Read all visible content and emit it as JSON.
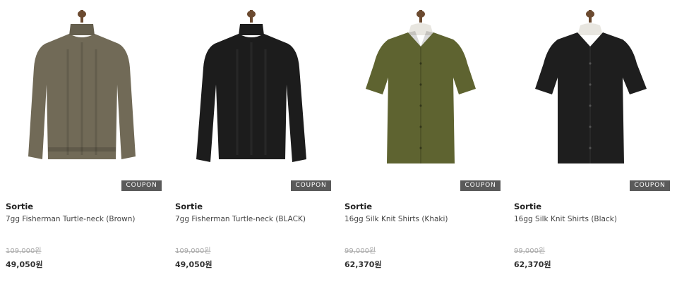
{
  "products": [
    {
      "coupon": "COUPON",
      "brand": "Sortie",
      "name": "7gg Fisherman Turtle-neck (Brown)",
      "original_price": "109,000원",
      "sale_price": "49,050원",
      "garment": "turtleneck-sweater",
      "color": "#716a57"
    },
    {
      "coupon": "COUPON",
      "brand": "Sortie",
      "name": "7gg Fisherman Turtle-neck (BLACK)",
      "original_price": "109,000원",
      "sale_price": "49,050원",
      "garment": "turtleneck-sweater",
      "color": "#1c1c1c"
    },
    {
      "coupon": "COUPON",
      "brand": "Sortie",
      "name": "16gg Silk Knit Shirts (Khaki)",
      "original_price": "99,000원",
      "sale_price": "62,370원",
      "garment": "short-sleeve-knit-shirt",
      "color": "#5e6330"
    },
    {
      "coupon": "COUPON",
      "brand": "Sortie",
      "name": "16gg Silk Knit Shirts (Black)",
      "original_price": "99,000원",
      "sale_price": "62,370원",
      "garment": "short-sleeve-knit-shirt",
      "color": "#1e1e1e"
    }
  ]
}
